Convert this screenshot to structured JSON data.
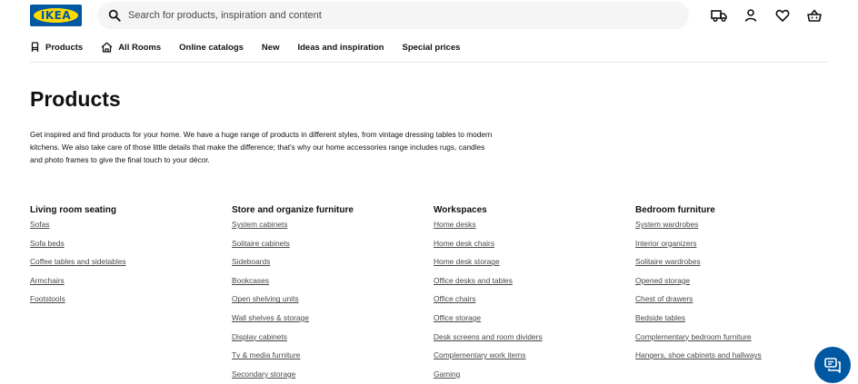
{
  "header": {
    "logo_text": "IKEA",
    "search_placeholder": "Search for products, inspiration and content",
    "icons": [
      "delivery-truck-icon",
      "user-icon",
      "heart-icon",
      "shopping-basket-icon"
    ]
  },
  "nav": {
    "items": [
      {
        "label": "Products",
        "icon": "chair-icon"
      },
      {
        "label": "All Rooms",
        "icon": "home-icon"
      },
      {
        "label": "Online catalogs"
      },
      {
        "label": "New"
      },
      {
        "label": "Ideas and inspiration"
      },
      {
        "label": "Special prices"
      }
    ]
  },
  "page": {
    "title": "Products",
    "intro": "Get inspired and find products for your home. We have a huge range of products in different styles, from vintage dressing tables to modern kitchens. We also take care of those little details that make the difference; that's why our home accessories range includes rugs, candles and photo frames to give the final touch to your décor."
  },
  "categories": [
    {
      "heading": "Living room seating",
      "links": [
        "Sofas",
        "Sofa beds",
        "Coffee tables and sidetables",
        "Armchairs",
        "Footstools"
      ]
    },
    {
      "heading": "Store and organize furniture",
      "links": [
        "System cabinets",
        "Solitaire cabinets",
        "Sideboards",
        "Bookcases",
        "Open shelving units",
        "Wall shelves & storage",
        "Display cabinets",
        "Tv & media furniture",
        "Secondary storage"
      ]
    },
    {
      "heading": "Workspaces",
      "links": [
        "Home desks",
        "Home desk chairs",
        "Home desk storage",
        "Office desks and tables",
        "Office chairs",
        "Office storage",
        "Desk screens and room dividers",
        "Complementary work items",
        "Gaming"
      ]
    },
    {
      "heading": "Bedroom furniture",
      "links": [
        "System wardrobes",
        "Interior organizers",
        "Solitaire wardrobes",
        "Opened storage",
        "Chest of drawers",
        "Bedside tables",
        "Complementary bedroom furniture",
        "Hangers, shoe cabinets and hallways"
      ]
    }
  ],
  "colors": {
    "brand_blue": "#0058a3",
    "brand_yellow": "#ffdb00",
    "text": "#111111",
    "link": "#484848",
    "search_bg": "#f5f5f5"
  },
  "chat": {
    "icon": "chat-icon"
  }
}
